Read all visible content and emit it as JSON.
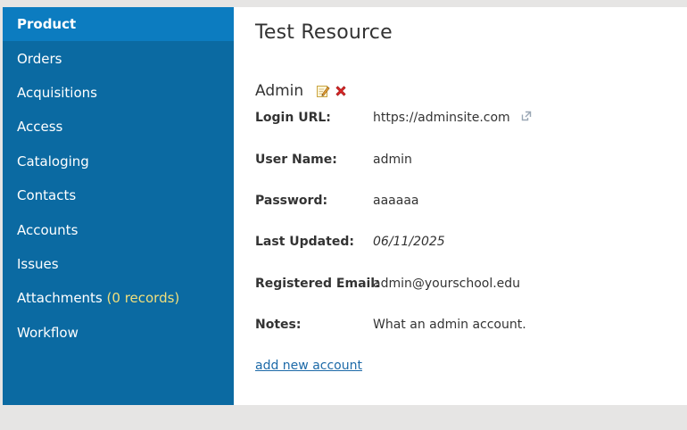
{
  "sidebar": {
    "items": [
      {
        "label": "Product",
        "active": true
      },
      {
        "label": "Orders"
      },
      {
        "label": "Acquisitions"
      },
      {
        "label": "Access"
      },
      {
        "label": "Cataloging"
      },
      {
        "label": "Contacts"
      },
      {
        "label": "Accounts"
      },
      {
        "label": "Issues"
      },
      {
        "label": "Attachments",
        "count": "(0 records)"
      },
      {
        "label": "Workflow"
      }
    ],
    "background": "#0b6aa2",
    "active_background": "#0c7cc0",
    "count_color": "#f1df7c"
  },
  "main": {
    "title": "Test Resource",
    "section_title": "Admin",
    "icons": {
      "edit": "edit-pencil-icon",
      "delete": "delete-x-icon",
      "link": "external-link-icon"
    },
    "fields": [
      {
        "label": "Login URL:",
        "value": "https://adminsite.com"
      },
      {
        "label": "User Name:",
        "value": "admin"
      },
      {
        "label": "Password:",
        "value": "aaaaaa"
      },
      {
        "label": "Last Updated:",
        "value": "06/11/2025"
      },
      {
        "label": "Registered Email:",
        "value": "admin@yourschool.edu"
      },
      {
        "label": "Notes:",
        "value": "What an admin account."
      }
    ],
    "add_link": "add new account",
    "link_color": "#1d6aa8"
  }
}
